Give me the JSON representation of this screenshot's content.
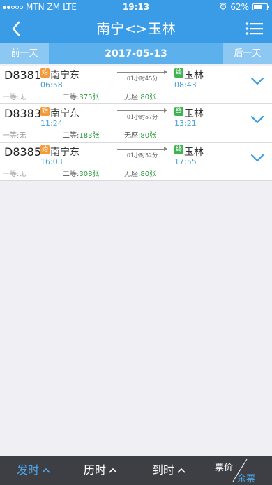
{
  "status_bar": {
    "carrier": "MTN ZM",
    "network": "LTE",
    "time": "19:13",
    "battery_percent": "62%",
    "battery_level": 0.62,
    "signal_bars": 2
  },
  "nav": {
    "title": "南宁<>玉林",
    "back_icon": "chevron-left-icon",
    "menu_icon": "list-menu-icon"
  },
  "date_bar": {
    "prev_label": "前一天",
    "current_date": "2017-05-13",
    "next_label": "后一天"
  },
  "trains": [
    {
      "number": "D8381",
      "start_badge": "始",
      "from": "南宁东",
      "dep_time": "06:58",
      "duration": "01小时45分",
      "end_badge": "终",
      "to": "玉林",
      "arr_time": "08:43",
      "first_class": "一等:无",
      "second_label": "二等:",
      "second_count": "375张",
      "noseat_label": "无座:",
      "noseat_count": "80张"
    },
    {
      "number": "D8383",
      "start_badge": "始",
      "from": "南宁东",
      "dep_time": "11:24",
      "duration": "01小时57分",
      "end_badge": "终",
      "to": "玉林",
      "arr_time": "13:21",
      "first_class": "一等:无",
      "second_label": "二等:",
      "second_count": "183张",
      "noseat_label": "无座:",
      "noseat_count": "80张"
    },
    {
      "number": "D8385",
      "start_badge": "始",
      "from": "南宁东",
      "dep_time": "16:03",
      "duration": "01小时52分",
      "end_badge": "终",
      "to": "玉林",
      "arr_time": "17:55",
      "first_class": "一等:无",
      "second_label": "二等:",
      "second_count": "308张",
      "noseat_label": "无座:",
      "noseat_count": "80张"
    }
  ],
  "bottom_bar": {
    "dep_label": "发时",
    "dur_label": "历时",
    "arr_label": "到时",
    "price_label": "票价",
    "remain_label": "余票",
    "active_color": "#4ba8ee"
  },
  "colors": {
    "header": "#3a9ce6",
    "date_bar": "#5cb0ec",
    "start_badge": "#f39a3a",
    "end_badge": "#3eb34f",
    "seat_count": "#2a9a3a",
    "time": "#4b9fd8"
  }
}
